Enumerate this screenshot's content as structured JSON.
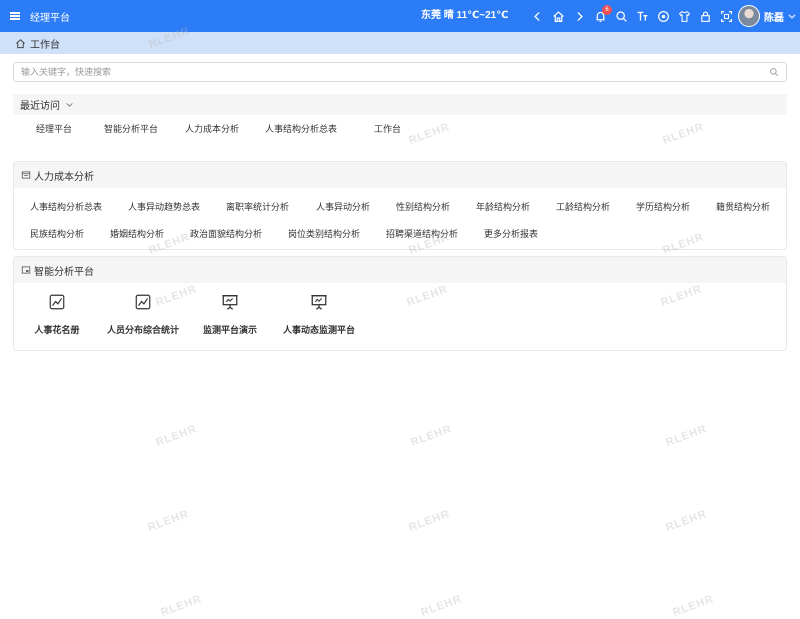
{
  "app": {
    "title": "经理平台"
  },
  "header": {
    "weather": "东莞 晴 11℃~21℃",
    "notification_count": "6",
    "user_name": "陈磊",
    "icons": [
      "chevron-left-icon",
      "chevron-right-icon",
      "home-icon",
      "bell-icon",
      "search-icon",
      "font-size-icon",
      "theme-icon",
      "shirt-icon",
      "lock-icon",
      "fullscreen-icon"
    ]
  },
  "breadcrumb": {
    "label": "工作台"
  },
  "search": {
    "placeholder": "输入关键字，快速搜索"
  },
  "recent": {
    "title": "最近访问",
    "items": [
      "经理平台",
      "智能分析平台",
      "人力成本分析",
      "人事结构分析总表",
      "工作台"
    ]
  },
  "hr_cost": {
    "title": "人力成本分析",
    "links": [
      "人事结构分析总表",
      "人事异动趋势总表",
      "离职率统计分析",
      "人事异动分析",
      "性别结构分析",
      "年龄结构分析",
      "工龄结构分析",
      "学历结构分析",
      "籍贯结构分析",
      "民族结构分析",
      "婚姻结构分析",
      "政治面貌结构分析",
      "岗位类别结构分析",
      "招聘渠道结构分析",
      "更多分析报表"
    ]
  },
  "smart": {
    "title": "智能分析平台",
    "tiles": [
      {
        "label": "人事花名册",
        "icon": "chart-line-icon"
      },
      {
        "label": "人员分布综合统计",
        "icon": "chart-line-icon"
      },
      {
        "label": "监测平台演示",
        "icon": "presentation-icon"
      },
      {
        "label": "人事动态监测平台",
        "icon": "presentation-icon"
      }
    ]
  },
  "watermark": "RLEHR",
  "colors": {
    "topbar": "#2b7cf6",
    "breadcrumb_bg": "#cfe1f9",
    "badge": "#f05050"
  }
}
